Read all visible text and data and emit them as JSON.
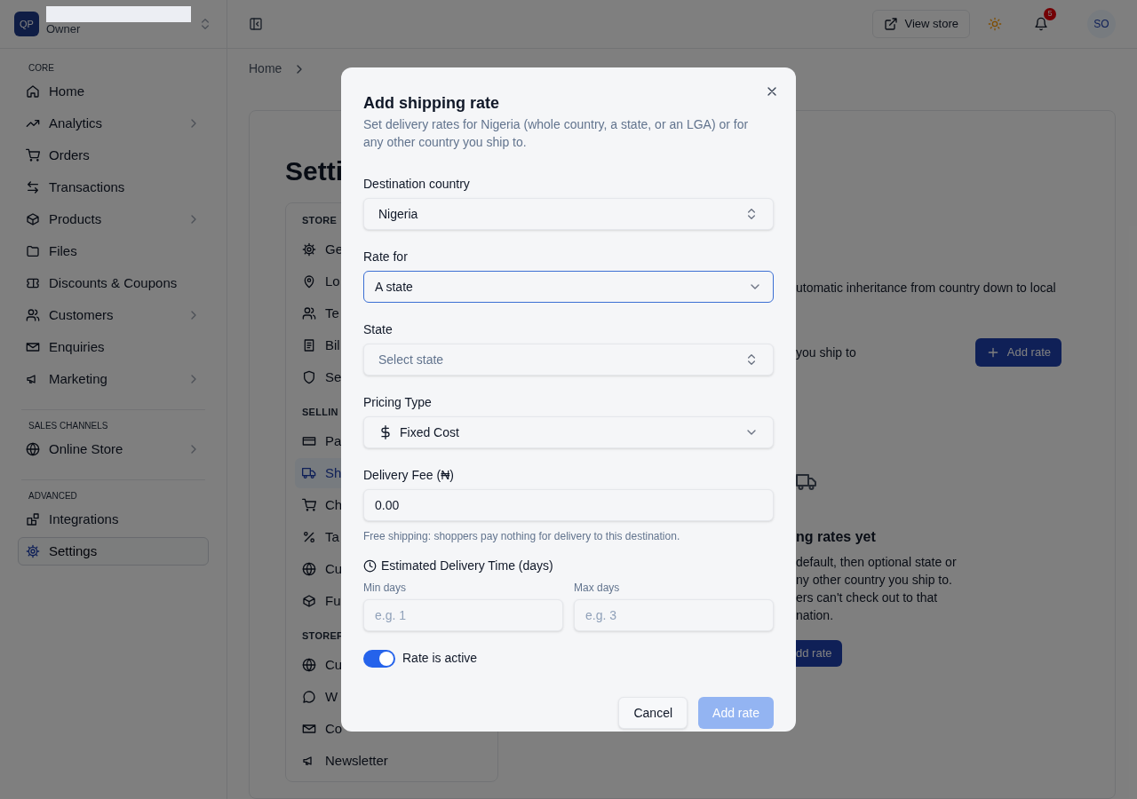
{
  "sidebar": {
    "brand": {
      "initials": "QP",
      "role": "Owner"
    },
    "sections": [
      {
        "label": "CORE",
        "items": [
          {
            "label": "Home",
            "expandable": false,
            "selected": false
          },
          {
            "label": "Analytics",
            "expandable": true,
            "selected": false
          },
          {
            "label": "Orders",
            "expandable": false,
            "selected": false
          },
          {
            "label": "Transactions",
            "expandable": false,
            "selected": false
          },
          {
            "label": "Products",
            "expandable": true,
            "selected": false
          },
          {
            "label": "Files",
            "expandable": false,
            "selected": false
          },
          {
            "label": "Discounts & Coupons",
            "expandable": false,
            "selected": false
          },
          {
            "label": "Customers",
            "expandable": true,
            "selected": false
          },
          {
            "label": "Enquiries",
            "expandable": false,
            "selected": false
          },
          {
            "label": "Marketing",
            "expandable": true,
            "selected": false
          }
        ]
      },
      {
        "label": "SALES CHANNELS",
        "items": [
          {
            "label": "Online Store",
            "expandable": true,
            "selected": false
          }
        ]
      },
      {
        "label": "ADVANCED",
        "items": [
          {
            "label": "Integrations",
            "expandable": false,
            "selected": false
          },
          {
            "label": "Settings",
            "expandable": false,
            "selected": true
          }
        ]
      }
    ]
  },
  "header": {
    "view_store": "View store",
    "notifications": "5",
    "avatar": "SO"
  },
  "breadcrumb": [
    "Home"
  ],
  "page_title": "Setti",
  "settings_nav": [
    {
      "label": "STORE",
      "items": [
        {
          "label": "Ge",
          "selected": false
        },
        {
          "label": "Lo",
          "selected": false
        },
        {
          "label": "Te",
          "selected": false
        },
        {
          "label": "Bil",
          "selected": false
        },
        {
          "label": "Se",
          "selected": false
        }
      ]
    },
    {
      "label": "SELLIN",
      "items": [
        {
          "label": "Pa",
          "selected": false
        },
        {
          "label": "Sh",
          "selected": true
        },
        {
          "label": "Ch",
          "selected": false
        },
        {
          "label": "Ta",
          "selected": false
        },
        {
          "label": "Cu",
          "selected": false
        },
        {
          "label": "Fu",
          "selected": false
        }
      ]
    },
    {
      "label": "STOREF",
      "items": [
        {
          "label": "Cu",
          "selected": false
        },
        {
          "label": "W",
          "selected": false
        },
        {
          "label": "Co",
          "selected": false
        },
        {
          "label": "Newsletter",
          "selected": false
        }
      ]
    }
  ],
  "shipping_panel": {
    "description": "utomatic inheritance from country down to local",
    "subtitle": "you ship to",
    "add_button": "Add rate",
    "empty_state": {
      "title": "ng rates yet",
      "lines": [
        "default, then optional state or",
        "ny other country you ship to.",
        "ers can't check out to that",
        "nation."
      ],
      "button": "dd rate"
    }
  },
  "dialog": {
    "title": "Add shipping rate",
    "description": "Set delivery rates for Nigeria (whole country, a state, or an LGA) or for any other country you ship to.",
    "fields": [
      {
        "kind": "combobox",
        "label": "Destination country",
        "value": "Nigeria",
        "focused": false
      },
      {
        "kind": "select",
        "label": "Rate for",
        "value": "A state",
        "focused": true
      },
      {
        "kind": "combobox",
        "label": "State",
        "placeholder": "Select state",
        "focused": false
      },
      {
        "kind": "price-select",
        "label": "Pricing Type",
        "value": "Fixed Cost",
        "focused": false
      },
      {
        "kind": "text",
        "label": "Delivery Fee (₦)",
        "value": "0.00",
        "help": "Free shipping: shoppers pay nothing for delivery to this destination.",
        "focused": false
      }
    ],
    "delivery_time": {
      "label": "Estimated Delivery Time (days)",
      "min": {
        "label": "Min days",
        "placeholder": "e.g. 1"
      },
      "max": {
        "label": "Max days",
        "placeholder": "e.g. 3"
      }
    },
    "toggle": {
      "label": "Rate is active",
      "on": true
    },
    "cancel": "Cancel",
    "submit": {
      "label": "Add rate",
      "disabled": true
    }
  }
}
